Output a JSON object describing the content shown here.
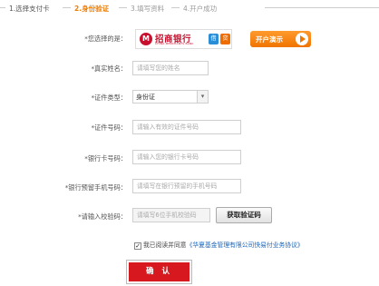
{
  "steps": [
    {
      "label": "1.选择支付卡",
      "state": "done"
    },
    {
      "label": "2.身份验证",
      "state": "active"
    },
    {
      "label": "3.填写资料",
      "state": "pending"
    },
    {
      "label": "4.开户成功",
      "state": "pending"
    }
  ],
  "form": {
    "bank_label": "*您选择的是：",
    "bank": {
      "name": "招商银行",
      "sub": "CHINA MERCHANTS BANK",
      "tag1": "借",
      "tag2": "贷"
    },
    "demo_button": "开户演示",
    "name_label": "*真实姓名：",
    "name_placeholder": "请填写您的姓名",
    "id_type_label": "*证件类型：",
    "id_type_value": "身份证",
    "id_number_label": "*证件号码：",
    "id_number_placeholder": "请输入有效的证件号码",
    "card_label": "*银行卡号码：",
    "card_placeholder": "请输入您的银行卡号码",
    "phone_label": "*银行预留手机号码：",
    "phone_placeholder": "请填写在银行预留的手机号码",
    "code_label": "*请输入校验码：",
    "code_placeholder": "请填写6位手机校验码",
    "code_button": "获取验证码",
    "agree_text": "我已阅读并同意",
    "agree_link": "《华夏基金管理有限公司快易付业务协议》",
    "confirm_button": "确 认"
  },
  "colors": {
    "accent": "#f07d00",
    "confirm": "#d7191f",
    "link": "#1a63b8"
  }
}
